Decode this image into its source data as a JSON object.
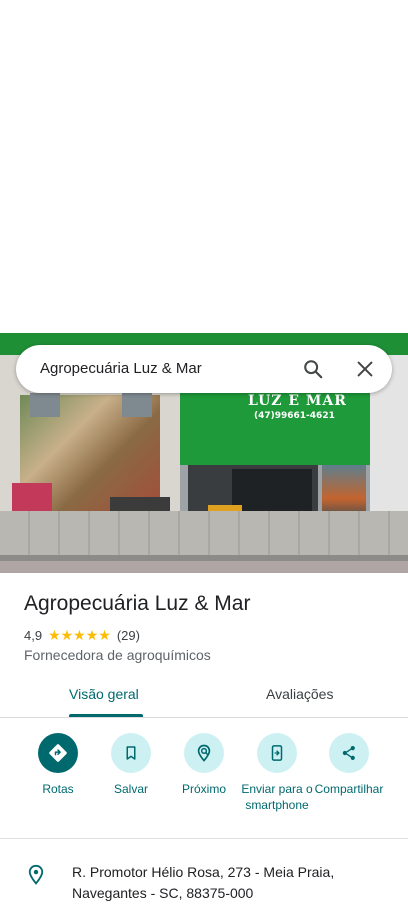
{
  "search": {
    "query": "Agropecuária Luz & Mar"
  },
  "photo": {
    "sign_text": "LUZ E MAR",
    "sign_phone": "(47)99661-4621"
  },
  "place": {
    "name": "Agropecuária Luz & Mar",
    "rating": "4,9",
    "stars": "★★★★★",
    "review_count": "(29)",
    "category": "Fornecedora de agroquímicos"
  },
  "tabs": [
    {
      "label": "Visão geral",
      "active": true
    },
    {
      "label": "Avaliações",
      "active": false
    }
  ],
  "actions": [
    {
      "label": "Rotas",
      "icon": "directions-icon"
    },
    {
      "label": "Salvar",
      "icon": "bookmark-icon"
    },
    {
      "label": "Próximo",
      "icon": "nearby-icon"
    },
    {
      "label": "Enviar para o smartphone",
      "icon": "send-to-phone-icon"
    },
    {
      "label": "Compartilhar",
      "icon": "share-icon"
    }
  ],
  "address": {
    "line1": "R. Promotor Hélio Rosa, 273 - Meia Praia,",
    "line2": "Navegantes - SC, 88375-000"
  },
  "colors": {
    "accent": "#00696e",
    "accent_light": "#cdf1f3",
    "star": "#fbbc04"
  }
}
